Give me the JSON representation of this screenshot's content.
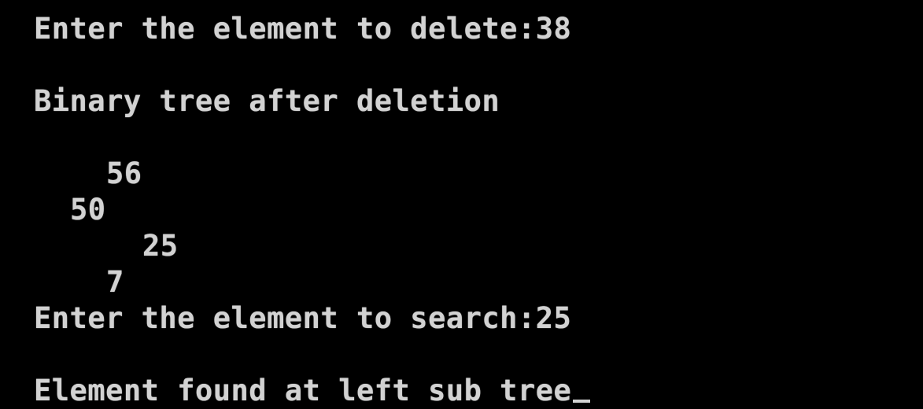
{
  "console": {
    "prompt_delete": "Enter the element to delete:38",
    "tree_heading": "Binary tree after deletion",
    "tree_nodes": [
      "56",
      "50",
      "25",
      "7"
    ],
    "prompt_search": "Enter the element to search:25",
    "result": "Element found at left sub tree"
  }
}
